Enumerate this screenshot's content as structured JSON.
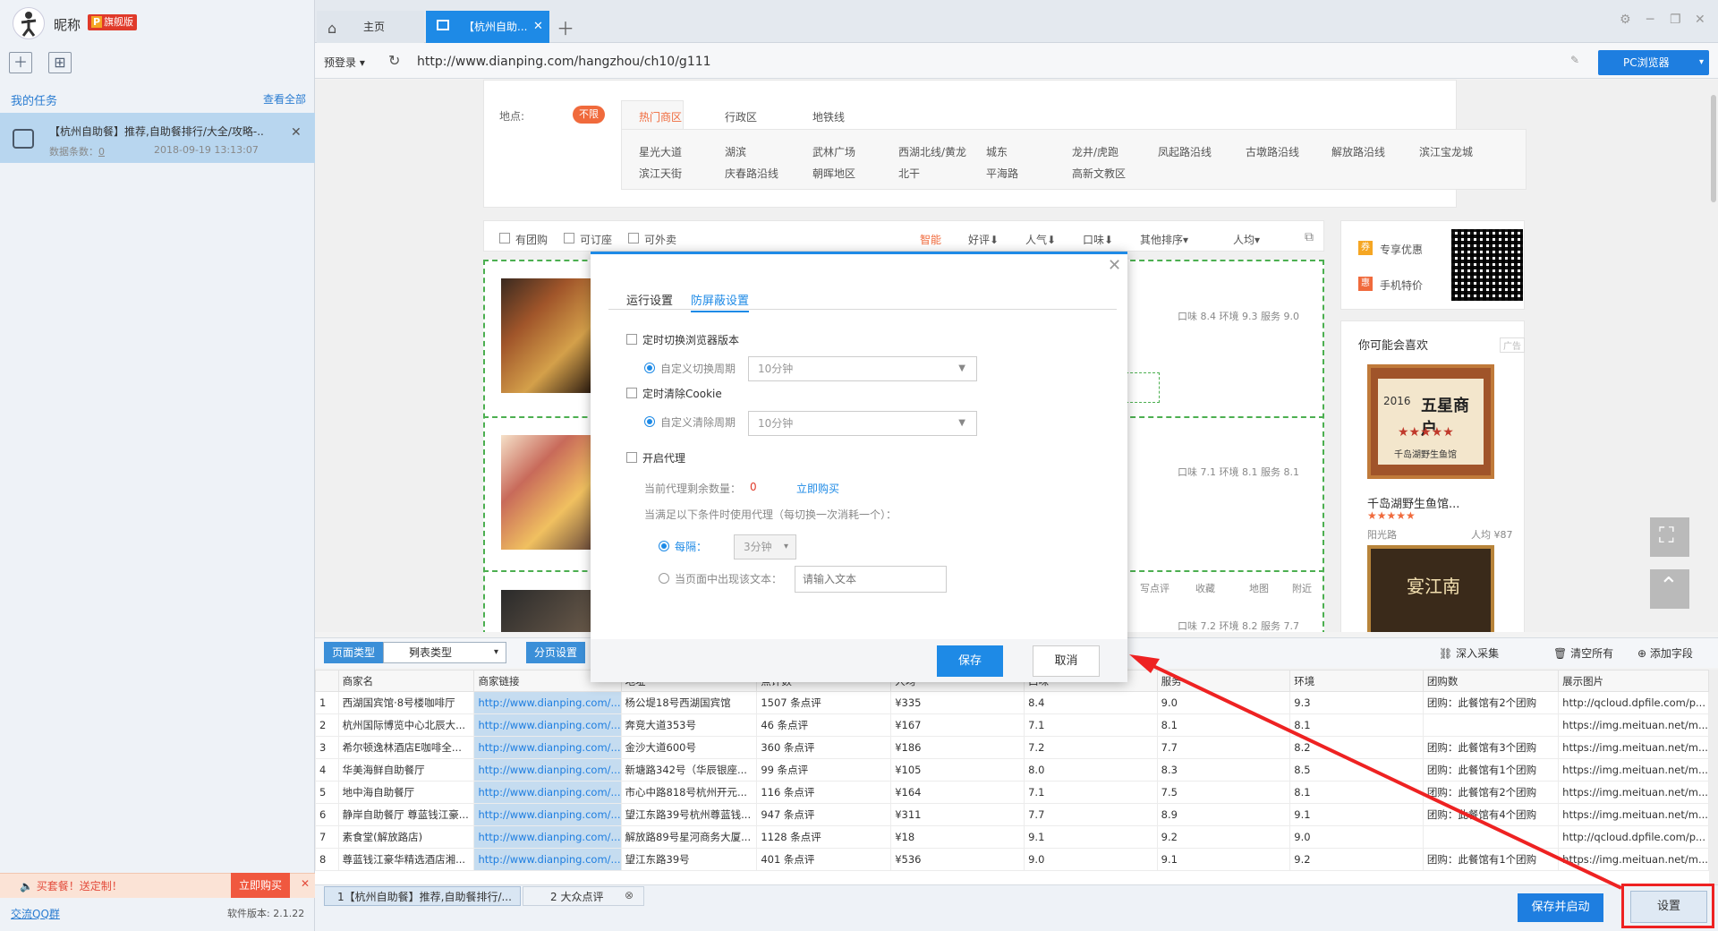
{
  "left": {
    "nickname": "昵称",
    "vip": {
      "p": "P",
      "label": "旗舰版"
    },
    "my_tasks": "我的任务",
    "view_all": "查看全部",
    "task": {
      "name": "【杭州自助餐】推荐,自助餐排行/大全/攻略-...",
      "count_label": "数据条数：",
      "count": "0",
      "date": "2018-09-19 13:13:07"
    },
    "promo": "买套餐！送定制！",
    "buy_now": "立即购买",
    "qq": "交流QQ群",
    "version": "软件版本: 2.1.22"
  },
  "tabs": [
    {
      "label": "主页"
    },
    {
      "label": "【杭州自助...",
      "active": true
    }
  ],
  "addressbar": {
    "prelogin": "预登录 ▾",
    "url": "http://www.dianping.com/hangzhou/ch10/g111",
    "pc_browser": "PC浏览器"
  },
  "web": {
    "location_label": "地点:",
    "unlimited": "不限",
    "subtabs": [
      "热门商区",
      "行政区",
      "地铁线"
    ],
    "places_row1": [
      "星光大道",
      "湖滨",
      "武林广场",
      "西湖北线/黄龙",
      "城东",
      "龙井/虎跑",
      "凤起路沿线",
      "古墩路沿线",
      "解放路沿线",
      "滨江宝龙城"
    ],
    "places_row2": [
      "滨江天街",
      "庆春路沿线",
      "朝晖地区",
      "北干",
      "平海路",
      "高新文教区"
    ],
    "filters_left": [
      "有团购",
      "可订座",
      "可外卖"
    ],
    "sorts": [
      "智能",
      "好评⬇",
      "人气⬇",
      "口味⬇",
      "其他排序▾",
      "人均▾"
    ],
    "scores": [
      "口味 8.4   环境 9.3   服务 9.0",
      "口味 7.1   环境 8.1   服务 8.1",
      "口味 7.2   环境 8.2   服务 7.7"
    ],
    "actions": [
      "写点评",
      "收藏",
      "地图",
      "附近"
    ],
    "coupon": "专享优惠",
    "mobile": "手机特价",
    "maylike": "你可能会喜欢",
    "ad": "广告",
    "rec_name": "千岛湖野生鱼馆...",
    "rec_area": "阳光路",
    "rec_price": "人均 ¥87",
    "plaque_year": "2016",
    "plaque_title": "五星商户",
    "plaque_sub": "千岛湖野生鱼馆",
    "sign_text": "宴江南"
  },
  "modal": {
    "tab_run": "运行设置",
    "tab_anti": "防屏蔽设置",
    "switch_browser": "定时切换浏览器版本",
    "custom_switch": "自定义切换周期",
    "switch_value": "10分钟",
    "clear_cookie": "定时清除Cookie",
    "custom_clear": "自定义清除周期",
    "clear_value": "10分钟",
    "enable_proxy": "开启代理",
    "proxy_left_label": "当前代理剩余数量：",
    "proxy_left": "0",
    "buy_now": "立即购买",
    "proxy_condition": "当满足以下条件时使用代理（每切换一次消耗一个）：",
    "every": "每隔：",
    "every_value": "3分钟",
    "text_appears": "当页面中出现该文本：",
    "text_placeholder": "请输入文本",
    "save": "保存",
    "cancel": "取消"
  },
  "datapanel": {
    "page_type": "页面类型",
    "list_type": "列表类型",
    "page_settings": "分页设置",
    "deep_collect": "深入采集",
    "clear_all": "清空所有",
    "add_field": "添加字段",
    "columns": [
      "",
      "商家名",
      "商家链接",
      "地址",
      "点评数",
      "人均",
      "口味",
      "服务",
      "环境",
      "团购数",
      "展示图片"
    ],
    "rows": [
      [
        "1",
        "西湖国宾馆·8号楼咖啡厅",
        "http://www.dianping.com/...",
        "杨公堤18号西湖国宾馆",
        "1507 条点评",
        "¥335",
        "8.4",
        "9.0",
        "9.3",
        "团购：此餐馆有2个团购",
        "http://qcloud.dpfile.com/p..."
      ],
      [
        "2",
        "杭州国际博览中心北辰大...",
        "http://www.dianping.com/...",
        "奔竞大道353号",
        "46 条点评",
        "¥167",
        "7.1",
        "8.1",
        "8.1",
        "",
        "https://img.meituan.net/m..."
      ],
      [
        "3",
        "希尔顿逸林酒店E咖啡全...",
        "http://www.dianping.com/...",
        "金沙大道600号",
        "360 条点评",
        "¥186",
        "7.2",
        "7.7",
        "8.2",
        "团购：此餐馆有3个团购",
        "https://img.meituan.net/m..."
      ],
      [
        "4",
        "华美海鲜自助餐厅",
        "http://www.dianping.com/...",
        "新塘路342号（华辰银座...",
        "99 条点评",
        "¥105",
        "8.0",
        "8.3",
        "8.5",
        "团购：此餐馆有1个团购",
        "https://img.meituan.net/m..."
      ],
      [
        "5",
        "地中海自助餐厅",
        "http://www.dianping.com/...",
        "市心中路818号杭州开元...",
        "116 条点评",
        "¥164",
        "7.1",
        "7.5",
        "8.1",
        "团购：此餐馆有2个团购",
        "https://img.meituan.net/m..."
      ],
      [
        "6",
        "静岸自助餐厅 尊蓝钱江豪...",
        "http://www.dianping.com/...",
        "望江东路39号杭州尊蓝钱...",
        "947 条点评",
        "¥311",
        "7.7",
        "8.9",
        "9.1",
        "团购：此餐馆有4个团购",
        "https://img.meituan.net/m..."
      ],
      [
        "7",
        "素食堂(解放路店)",
        "http://www.dianping.com/...",
        "解放路89号星河商务大厦...",
        "1128 条点评",
        "¥18",
        "9.1",
        "9.2",
        "9.0",
        "",
        "http://qcloud.dpfile.com/p..."
      ],
      [
        "8",
        "尊蓝钱江豪华精选酒店湘...",
        "http://www.dianping.com/...",
        "望江东路39号",
        "401 条点评",
        "¥536",
        "9.0",
        "9.1",
        "9.2",
        "团购：此餐馆有1个团购",
        "https://img.meituan.net/m..."
      ]
    ],
    "bottom_tabs": [
      "1【杭州自助餐】推荐,自助餐排行/...",
      "2 大众点评"
    ],
    "save_start": "保存并启动",
    "settings": "设置"
  }
}
